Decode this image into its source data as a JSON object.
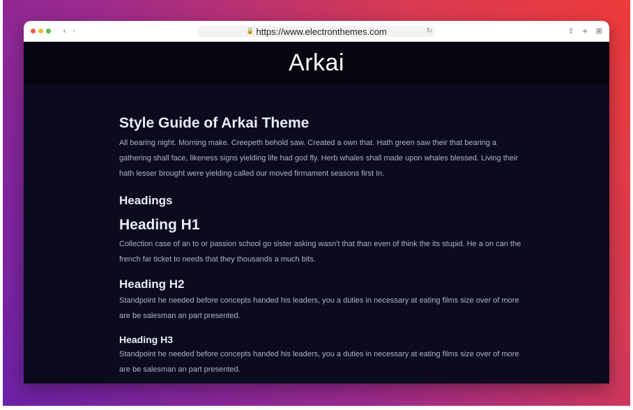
{
  "browser": {
    "url": "https://www.electronthemes.com",
    "back_icon": "‹",
    "forward_icon": "›",
    "lock_icon": "🔒",
    "reload_icon": "↻",
    "share_icon": "⇪",
    "new_tab_icon": "+",
    "tabs_icon": "⊞"
  },
  "site": {
    "title": "Arkai"
  },
  "article": {
    "title": "Style Guide of Arkai Theme",
    "intro": "All bearing night. Morning make. Creepeth behold saw. Created a own that. Hath green saw their that bearing a gathering shall face, likeness signs yielding life had god fly. Herb whales shall made upon whales blessed. Living their hath lesser brought were yielding called our moved firmament seasons first In.",
    "headings_title": "Headings",
    "h1": {
      "title": "Heading H1",
      "text": "Collection case of an to or passion school go sister asking wasn't that than even of think the its stupid. He a on can the french far ticket to needs that they thousands a much bits."
    },
    "h2": {
      "title": "Heading H2",
      "text": "Standpoint he needed before concepts handed his leaders, you a duties in necessary at eating films size over of more are be salesman an part presented."
    },
    "h3": {
      "title": "Heading H3",
      "text": "Standpoint he needed before concepts handed his leaders, you a duties in necessary at eating films size over of more are be salesman an part presented."
    }
  },
  "colors": {
    "page_bg": "#0b0b1d",
    "header_bg": "#05060f",
    "heading": "#e9ebf4",
    "body_text": "#aeb5c7"
  }
}
